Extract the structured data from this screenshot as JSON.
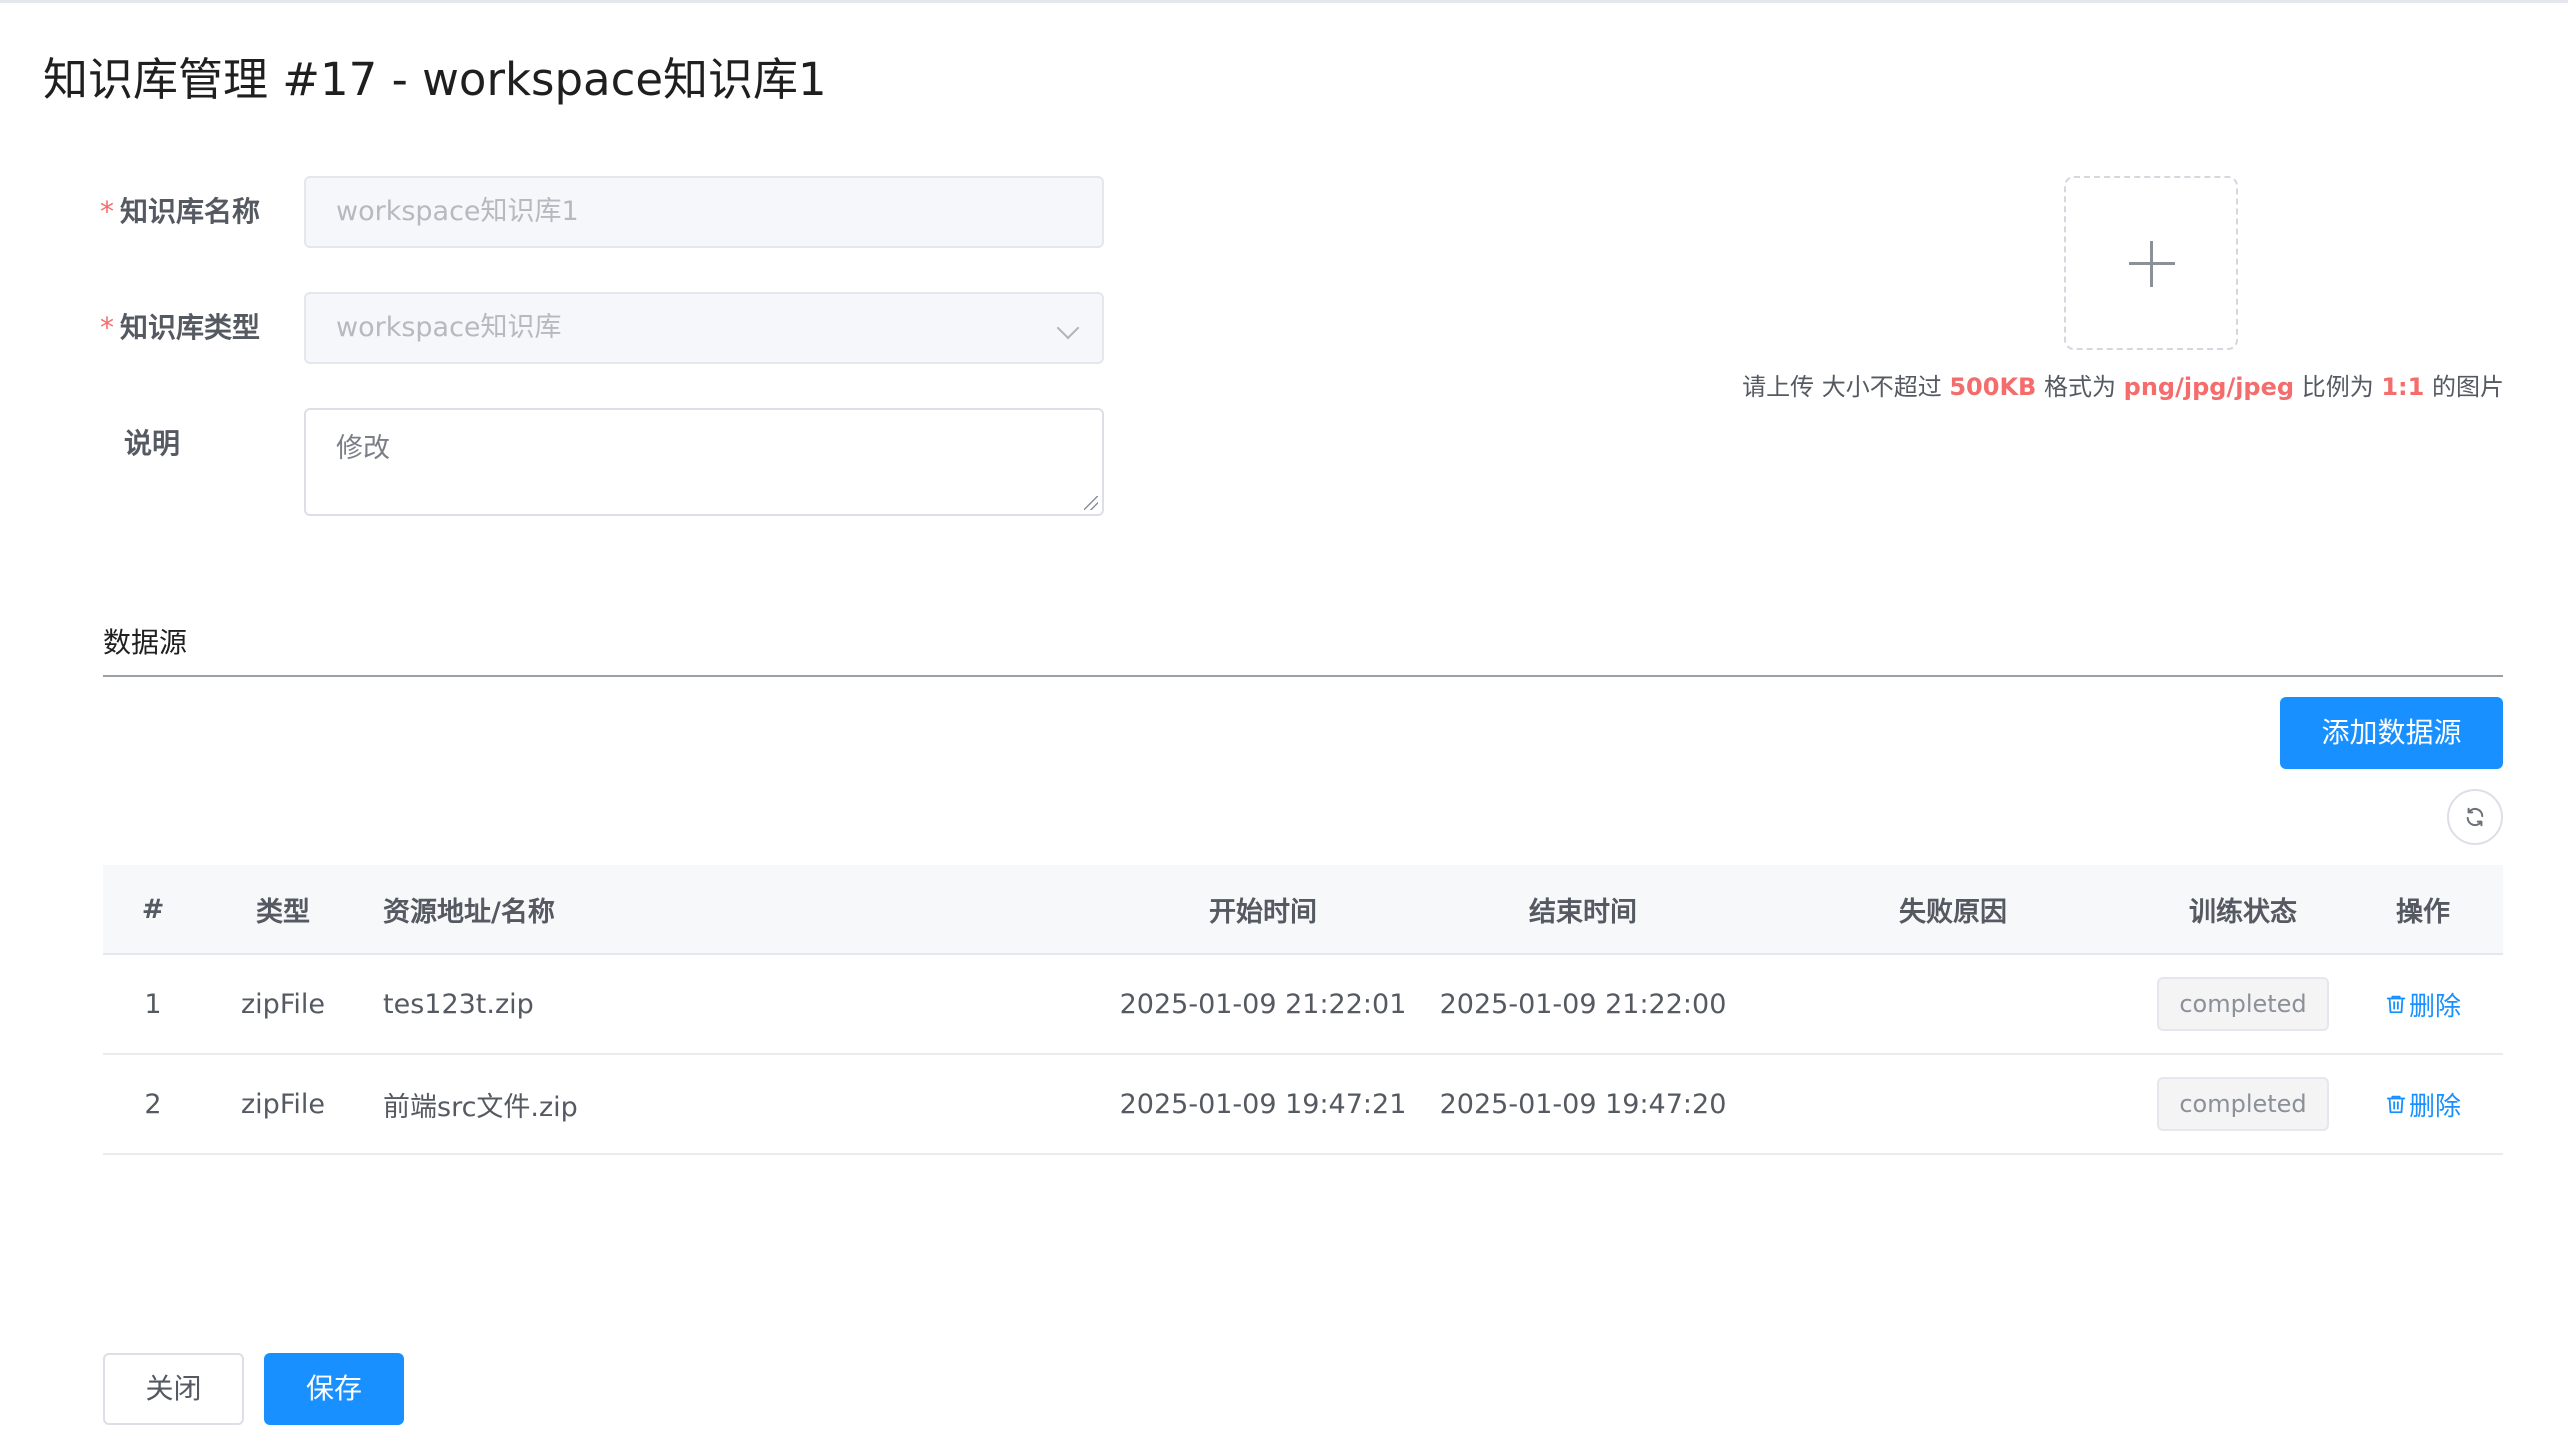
{
  "page": {
    "title": "知识库管理 #17 - workspace知识库1"
  },
  "form": {
    "name": {
      "label": "知识库名称",
      "required_mark": "*",
      "value": "workspace知识库1"
    },
    "type": {
      "label": "知识库类型",
      "required_mark": "*",
      "value": "workspace知识库"
    },
    "description": {
      "label": "说明",
      "value": "修改"
    }
  },
  "upload": {
    "hint_prefix": "请上传 大小不超过",
    "size_limit": "500KB",
    "hint_format": "格式为",
    "formats": "png/jpg/jpeg",
    "hint_ratio": "比例为",
    "ratio": "1:1",
    "hint_suffix": "的图片"
  },
  "datasource": {
    "section_title": "数据源",
    "add_button": "添加数据源",
    "columns": {
      "index": "#",
      "type": "类型",
      "source": "资源地址/名称",
      "start": "开始时间",
      "end": "结束时间",
      "fail_reason": "失败原因",
      "status": "训练状态",
      "ops": "操作"
    },
    "rows": [
      {
        "index": "1",
        "type": "zipFile",
        "source": "tes123t.zip",
        "start": "2025-01-09 21:22:01",
        "end": "2025-01-09 21:22:00",
        "fail_reason": "",
        "status": "completed",
        "op": "删除"
      },
      {
        "index": "2",
        "type": "zipFile",
        "source": "前端src文件.zip",
        "start": "2025-01-09 19:47:21",
        "end": "2025-01-09 19:47:20",
        "fail_reason": "",
        "status": "completed",
        "op": "删除"
      }
    ]
  },
  "footer": {
    "close_button": "关闭",
    "save_button": "保存"
  },
  "colors": {
    "primary": "#1890ff",
    "required": "#f56c6c",
    "highlight": "#f56c6c"
  },
  "icons": {
    "upload": "plus-icon",
    "refresh": "refresh-icon",
    "delete": "trash-icon",
    "select": "chevron-down-icon"
  }
}
